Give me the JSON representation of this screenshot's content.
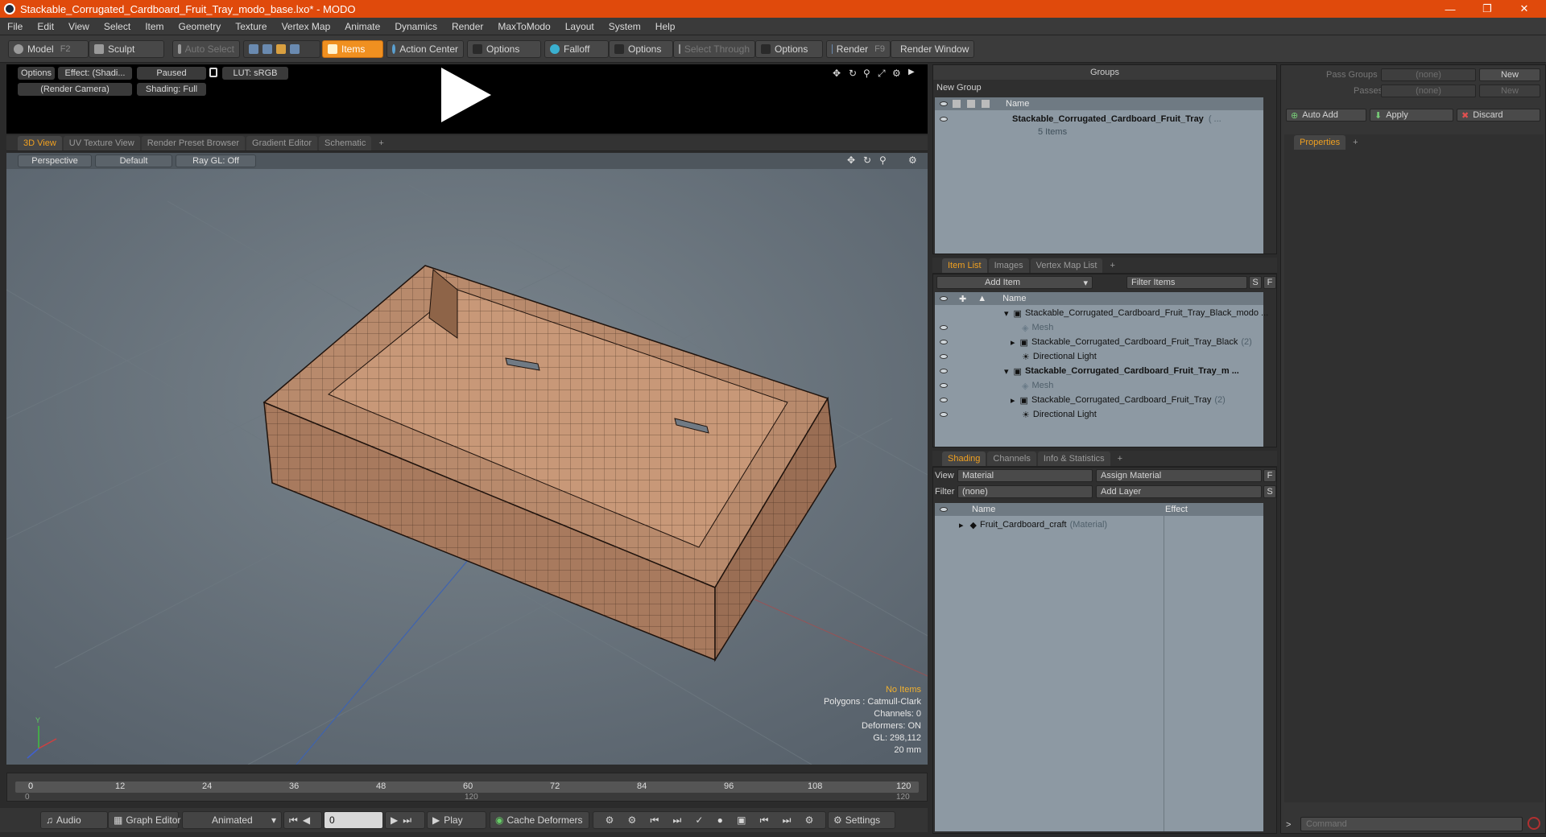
{
  "window": {
    "title": "Stackable_Corrugated_Cardboard_Fruit_Tray_modo_base.lxo* - MODO"
  },
  "menu": [
    "File",
    "Edit",
    "View",
    "Select",
    "Item",
    "Geometry",
    "Texture",
    "Vertex Map",
    "Animate",
    "Dynamics",
    "Render",
    "MaxToModo",
    "Layout",
    "System",
    "Help"
  ],
  "toolbar": {
    "model": "Model",
    "model_key": "F2",
    "sculpt": "Sculpt",
    "auto_select": "Auto Select",
    "items": "Items",
    "action_center": "Action Center",
    "options1": "Options",
    "falloff": "Falloff",
    "options2": "Options",
    "select_through": "Select Through",
    "options3": "Options",
    "render": "Render",
    "render_key": "F9",
    "render_window": "Render Window"
  },
  "preview": {
    "options": "Options",
    "effect": "Effect: (Shadi...",
    "paused": "Paused",
    "lut": "LUT: sRGB",
    "camera": "(Render Camera)",
    "shading": "Shading: Full"
  },
  "view_tabs": [
    "3D View",
    "UV Texture View",
    "Render Preset Browser",
    "Gradient Editor",
    "Schematic",
    "+"
  ],
  "viewport": {
    "perspective": "Perspective",
    "default": "Default",
    "raygl": "Ray GL: Off"
  },
  "stats": {
    "no_items": "No Items",
    "polygons": "Polygons : Catmull-Clark",
    "channels": "Channels: 0",
    "deformers": "Deformers: ON",
    "gl": "GL: 298,112",
    "scale": "20 mm"
  },
  "timeline": {
    "ticks": [
      "0",
      "12",
      "24",
      "36",
      "48",
      "60",
      "72",
      "84",
      "96",
      "108",
      "120"
    ],
    "sub": [
      "0",
      "120",
      "120"
    ]
  },
  "bottom": {
    "audio": "Audio",
    "graph_editor": "Graph Editor",
    "animated": "Animated",
    "frame": "0",
    "play": "Play",
    "cache": "Cache Deformers",
    "settings": "Settings"
  },
  "groups": {
    "title": "Groups",
    "new_group": "New Group",
    "name_col": "Name",
    "item": "Stackable_Corrugated_Cardboard_Fruit_Tray",
    "item_suffix": "( ...",
    "count": "5 Items"
  },
  "item_tabs": [
    "Item List",
    "Images",
    "Vertex Map List",
    "+"
  ],
  "item_list": {
    "add_item": "Add Item",
    "filter": "Filter Items",
    "s": "S",
    "f": "F",
    "name_col": "Name",
    "rows": [
      {
        "label": "Stackable_Corrugated_Cardboard_Fruit_Tray_Black_modo ...",
        "type": "scene"
      },
      {
        "label": "Mesh",
        "type": "mesh"
      },
      {
        "label": "Stackable_Corrugated_Cardboard_Fruit_Tray_Black",
        "suffix": "(2)",
        "type": "group"
      },
      {
        "label": "Directional Light",
        "type": "light"
      },
      {
        "label": "Stackable_Corrugated_Cardboard_Fruit_Tray_m ...",
        "type": "scene"
      },
      {
        "label": "Mesh",
        "type": "mesh"
      },
      {
        "label": "Stackable_Corrugated_Cardboard_Fruit_Tray",
        "suffix": "(2)",
        "type": "group"
      },
      {
        "label": "Directional Light",
        "type": "light"
      }
    ]
  },
  "shading_tabs": [
    "Shading",
    "Channels",
    "Info & Statistics",
    "+"
  ],
  "shading": {
    "view_label": "View",
    "view_value": "Material",
    "assign": "Assign Material",
    "filter_label": "Filter",
    "filter_value": "(none)",
    "add_layer": "Add Layer",
    "f": "F",
    "s": "S",
    "name_col": "Name",
    "effect_col": "Effect",
    "row": "Fruit_Cardboard_craft",
    "row_suffix": "(Material)"
  },
  "passes": {
    "pass_groups": "Pass Groups",
    "pass_groups_value": "(none)",
    "new1": "New",
    "passes": "Passes",
    "passes_value": "(none)",
    "new2": "New",
    "auto_add": "Auto Add",
    "apply": "Apply",
    "discard": "Discard",
    "properties": "Properties",
    "plus": "+"
  },
  "command": {
    "placeholder": "Command",
    "prompt": ">"
  }
}
